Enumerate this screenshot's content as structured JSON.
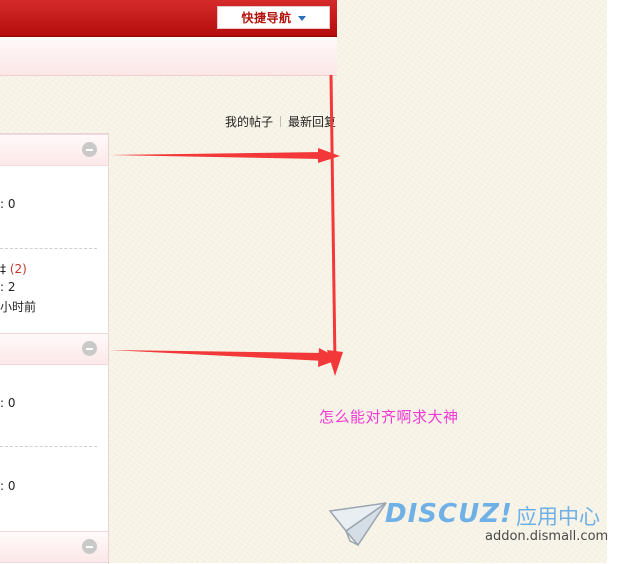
{
  "header": {
    "quick_nav_label": "快捷导航"
  },
  "links": {
    "my_posts": "我的帖子",
    "latest_replies": "最新回复"
  },
  "panel": {
    "block1": {
      "stat": ": 0"
    },
    "block2": {
      "line1_text": "‡",
      "line1_count": "(2)",
      "line2": ": 2",
      "line3": "小时前"
    },
    "block3": {
      "stat": ": 0"
    },
    "block4": {
      "stat": ": 0"
    }
  },
  "annotation": {
    "text": "怎么能对齐啊求大神",
    "color": "#f03ad4"
  },
  "watermark": {
    "brand": "DISCUZ!",
    "suffix": "应用中心",
    "url": "addon.dismall.com"
  },
  "colors": {
    "topbar": "#c41a1a",
    "arrow": "#f23838",
    "canvas": "#f7f3e6",
    "watermark_blue": "#6fb0e6"
  },
  "icons": {
    "collapse": "minus-circle-icon",
    "dropdown": "caret-down-icon",
    "watermark": "paper-plane-icon"
  }
}
